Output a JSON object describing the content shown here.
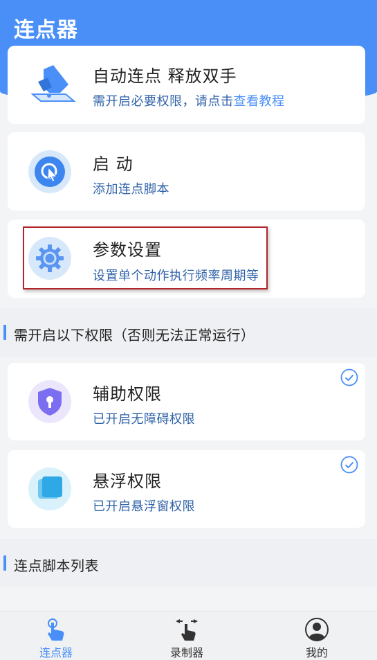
{
  "header": {
    "title": "连点器"
  },
  "cards": {
    "auto": {
      "title": "自动连点 释放双手",
      "sub_prefix": "需开启必要权限，请点击",
      "sub_link": "查看教程"
    },
    "start": {
      "title": "启 动",
      "sub": "添加连点脚本"
    },
    "params": {
      "title": "参数设置",
      "sub": "设置单个动作执行频率周期等"
    }
  },
  "permissions_section": {
    "title": "需开启以下权限（否则无法正常运行）"
  },
  "permissions": {
    "accessibility": {
      "title": "辅助权限",
      "sub": "已开启无障碍权限",
      "checked": true
    },
    "floating": {
      "title": "悬浮权限",
      "sub": "已开启悬浮窗权限",
      "checked": true
    }
  },
  "script_list_section": {
    "title": "连点脚本列表"
  },
  "bottom_nav": {
    "items": [
      {
        "label": "连点器",
        "icon": "tap-hand-icon",
        "active": true
      },
      {
        "label": "录制器",
        "icon": "record-gesture-icon",
        "active": false
      },
      {
        "label": "我的",
        "icon": "profile-icon",
        "active": false
      }
    ]
  },
  "colors": {
    "primary": "#4a8ff7",
    "link": "#2f62a8",
    "highlight": "#b3242a"
  }
}
